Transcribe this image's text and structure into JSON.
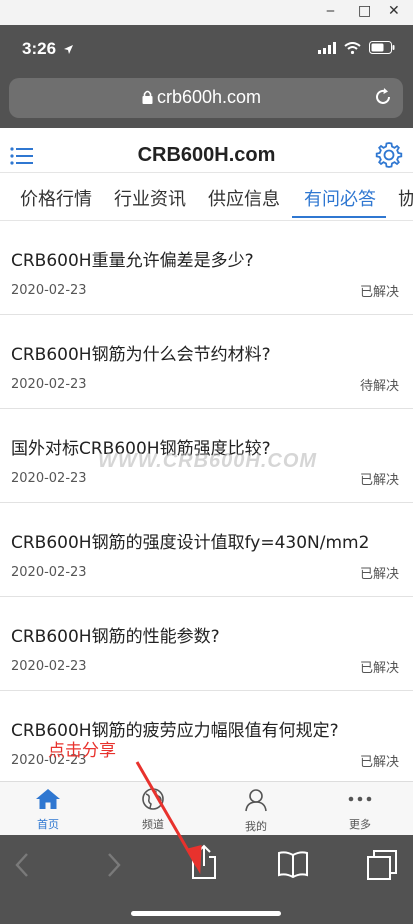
{
  "window_controls": {
    "minimize": "‒",
    "maximize": "□",
    "close": "✕"
  },
  "status_bar": {
    "time": "3:26"
  },
  "browser": {
    "url": "crb600h.com"
  },
  "site": {
    "title": "CRB600H.com"
  },
  "tabs": [
    {
      "label": "价格行情"
    },
    {
      "label": "行业资讯"
    },
    {
      "label": "供应信息"
    },
    {
      "label": "有问必答"
    },
    {
      "label": "协"
    }
  ],
  "questions": [
    {
      "title": "CRB600H重量允许偏差是多少?",
      "date": "2020-02-23",
      "status": "已解决"
    },
    {
      "title": "CRB600H钢筋为什么会节约材料?",
      "date": "2020-02-23",
      "status": "待解决"
    },
    {
      "title": "国外对标CRB600H钢筋强度比较?",
      "date": "2020-02-23",
      "status": "已解决"
    },
    {
      "title": "CRB600H钢筋的强度设计值取fy=430N/mm2",
      "date": "2020-02-23",
      "status": "已解决"
    },
    {
      "title": "CRB600H钢筋的性能参数?",
      "date": "2020-02-23",
      "status": "已解决"
    },
    {
      "title": "CRB600H钢筋的疲劳应力幅限值有何规定?",
      "date": "2020-02-23",
      "status": "已解决"
    }
  ],
  "watermark": "WWW.CRB600H.COM",
  "bottom_nav": [
    {
      "label": "首页",
      "icon": "home-icon"
    },
    {
      "label": "频道",
      "icon": "globe-icon"
    },
    {
      "label": "我的",
      "icon": "user-icon"
    },
    {
      "label": "更多",
      "icon": "more-icon"
    }
  ],
  "annotation": {
    "text": "点击分享",
    "color": "#e8322d"
  },
  "colors": {
    "accent": "#2f77d1",
    "chrome": "#525252"
  }
}
